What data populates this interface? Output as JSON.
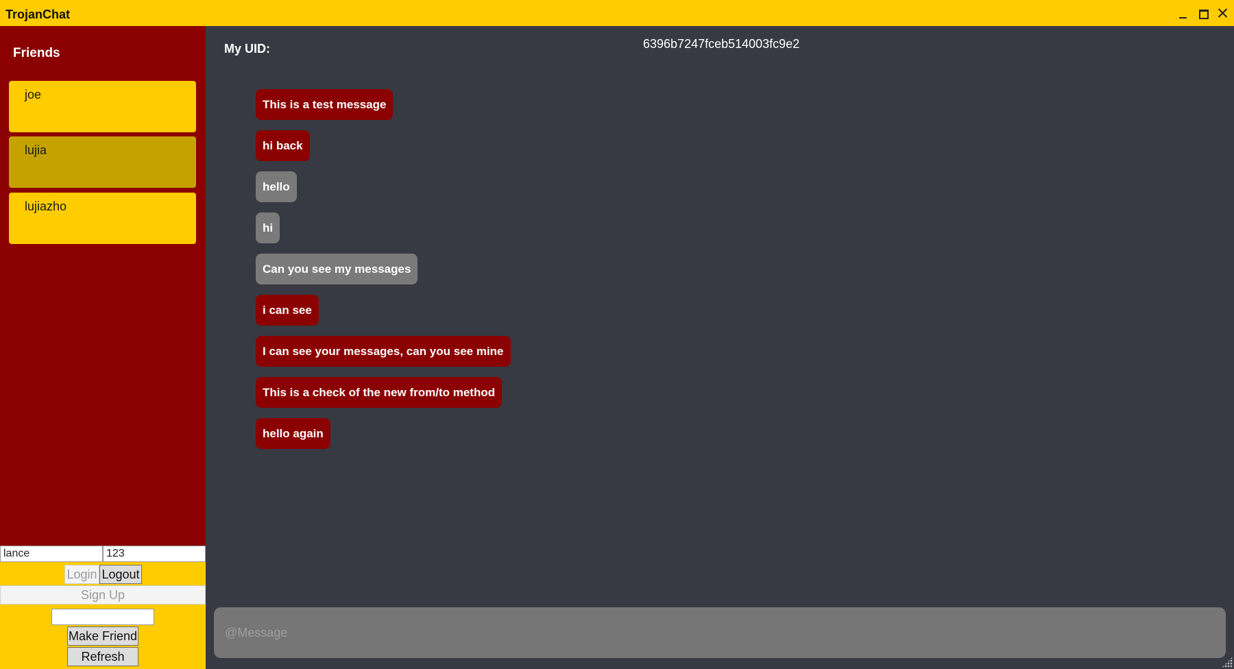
{
  "window": {
    "title": "TrojanChat",
    "controls": [
      "minimize-icon",
      "maximize-icon",
      "close-icon"
    ]
  },
  "colors": {
    "accent_yellow": "#ffcc00",
    "sidebar_red": "#8b0000",
    "chat_background": "#373a43",
    "my_message": "#8b0000",
    "their_message": "#7a7a7a",
    "selected_friend": "#c6a200"
  },
  "sidebar": {
    "heading": "Friends",
    "friends": [
      {
        "name": "joe",
        "selected": false
      },
      {
        "name": "lujia",
        "selected": true
      },
      {
        "name": "lujiazho",
        "selected": false
      }
    ]
  },
  "login": {
    "username_value": "lance",
    "password_value": "123",
    "login_label": "Login",
    "logout_label": "Logout",
    "signup_label": "Sign Up",
    "friend_input_value": "",
    "make_friend_label": "Make Friend",
    "refresh_label": "Refresh"
  },
  "header": {
    "uid_label": "My UID:",
    "uid_value": "6396b7247fceb514003fc9e2"
  },
  "messages": [
    {
      "text": "This is a test message",
      "sender": "me"
    },
    {
      "text": "hi back",
      "sender": "me"
    },
    {
      "text": "hello",
      "sender": "them"
    },
    {
      "text": "hi",
      "sender": "them"
    },
    {
      "text": "Can you see my messages",
      "sender": "them"
    },
    {
      "text": "i can see",
      "sender": "me"
    },
    {
      "text": "I can see your messages, can you see mine",
      "sender": "me"
    },
    {
      "text": "This is a check of the new from/to method",
      "sender": "me"
    },
    {
      "text": "hello again",
      "sender": "me"
    }
  ],
  "composer": {
    "placeholder": "@Message"
  }
}
